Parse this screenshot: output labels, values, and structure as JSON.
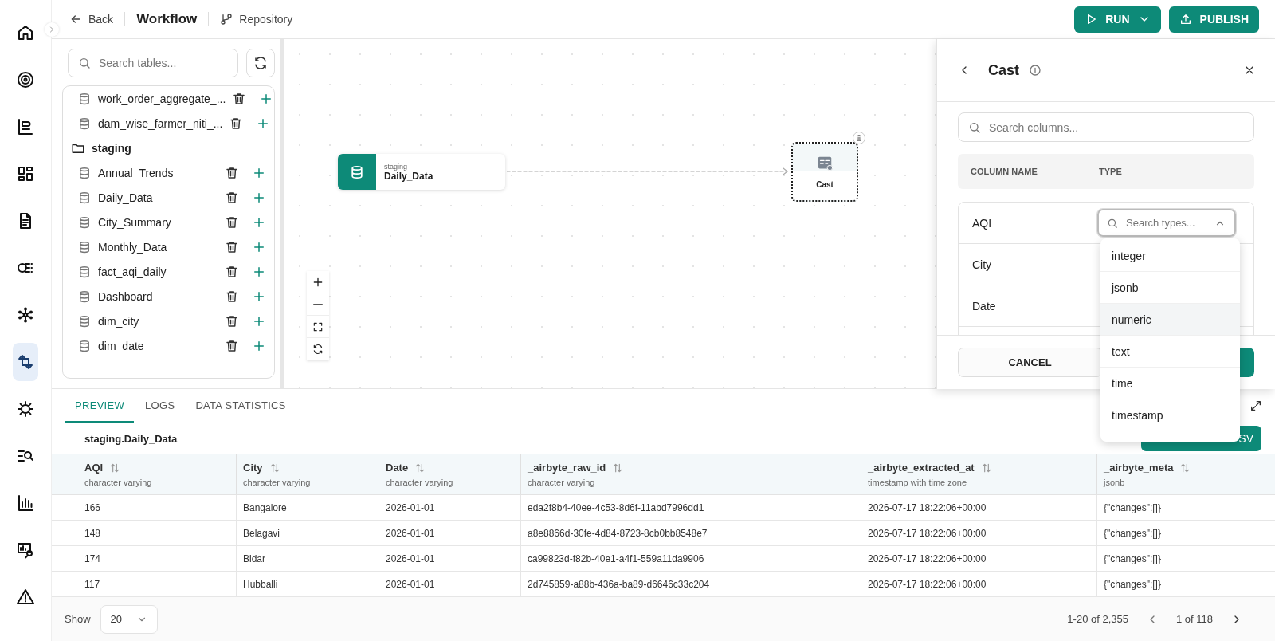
{
  "header": {
    "back": "Back",
    "title": "Workflow",
    "repository": "Repository",
    "run": "RUN",
    "publish": "PUBLISH"
  },
  "nav_rail": [
    {
      "selected": false
    },
    {
      "selected": false
    },
    {
      "selected": false
    },
    {
      "selected": false
    },
    {
      "selected": false
    },
    {
      "selected": false
    },
    {
      "selected": false
    },
    {
      "selected": true
    },
    {
      "selected": false
    },
    {
      "selected": false
    },
    {
      "selected": false
    },
    {
      "selected": false
    },
    {
      "selected": false
    }
  ],
  "table_browser": {
    "search_placeholder": "Search tables...",
    "items": [
      {
        "kind": "table",
        "name": "work_order_aggregate_..."
      },
      {
        "kind": "table",
        "name": "dam_wise_farmer_niti_..."
      },
      {
        "kind": "schema",
        "name": "staging"
      },
      {
        "kind": "table",
        "name": "Annual_Trends"
      },
      {
        "kind": "table",
        "name": "Daily_Data"
      },
      {
        "kind": "table",
        "name": "City_Summary"
      },
      {
        "kind": "table",
        "name": "Monthly_Data"
      },
      {
        "kind": "table",
        "name": "fact_aqi_daily"
      },
      {
        "kind": "table",
        "name": "Dashboard"
      },
      {
        "kind": "table",
        "name": "dim_city"
      },
      {
        "kind": "table",
        "name": "dim_date"
      }
    ]
  },
  "canvas": {
    "nodes": [
      {
        "kind": "source",
        "schema": "staging",
        "name": "Daily_Data",
        "selected": false
      },
      {
        "kind": "operation",
        "name": "Cast",
        "selected": true
      }
    ]
  },
  "cast_panel": {
    "title": "Cast",
    "search_placeholder": "Search columns...",
    "columns": [
      "COLUMN NAME",
      "TYPE"
    ],
    "rows": [
      {
        "name": "AQI"
      },
      {
        "name": "City"
      },
      {
        "name": "Date"
      }
    ],
    "type_select": {
      "placeholder": "Search types...",
      "expanded": true
    },
    "cancel": "CANCEL",
    "type_options": [
      {
        "label": "integer",
        "highlighted": false
      },
      {
        "label": "jsonb",
        "highlighted": false
      },
      {
        "label": "numeric",
        "highlighted": true
      },
      {
        "label": "text",
        "highlighted": false
      },
      {
        "label": "time",
        "highlighted": false
      },
      {
        "label": "timestamp",
        "highlighted": false
      }
    ]
  },
  "bottom": {
    "tabs": [
      {
        "label": "PREVIEW",
        "selected": true
      },
      {
        "label": "LOGS",
        "selected": false
      },
      {
        "label": "DATA STATISTICS",
        "selected": false
      }
    ],
    "title": "staging.Daily_Data",
    "download_visible_text": "SV",
    "table": {
      "columns": [
        {
          "name": "AQI",
          "type": "character varying"
        },
        {
          "name": "City",
          "type": "character varying"
        },
        {
          "name": "Date",
          "type": "character varying"
        },
        {
          "name": "_airbyte_raw_id",
          "type": "character varying"
        },
        {
          "name": "_airbyte_extracted_at",
          "type": "timestamp with time zone"
        },
        {
          "name": "_airbyte_meta",
          "type": "jsonb"
        }
      ],
      "rows": [
        [
          "166",
          "Bangalore",
          "2026-01-01",
          "eda2f8b4-40ee-4c53-8d6f-11abd7996dd1",
          "2026-07-17 18:22:06+00:00",
          "{\"changes\":[]}"
        ],
        [
          "148",
          "Belagavi",
          "2026-01-01",
          "a8e8866d-30fe-4d84-8723-8cb0bb8548e7",
          "2026-07-17 18:22:06+00:00",
          "{\"changes\":[]}"
        ],
        [
          "174",
          "Bidar",
          "2026-01-01",
          "ca99823d-f82b-40e1-a4f1-559a11da9906",
          "2026-07-17 18:22:06+00:00",
          "{\"changes\":[]}"
        ],
        [
          "117",
          "Hubballi",
          "2026-01-01",
          "2d745859-a88b-436a-ba89-d6646c33c204",
          "2026-07-17 18:22:06+00:00",
          "{\"changes\":[]}"
        ]
      ]
    },
    "footer": {
      "show_label": "Show",
      "page_size": "20",
      "range": "1-20 of 2,355",
      "page": "1 of 118"
    }
  }
}
